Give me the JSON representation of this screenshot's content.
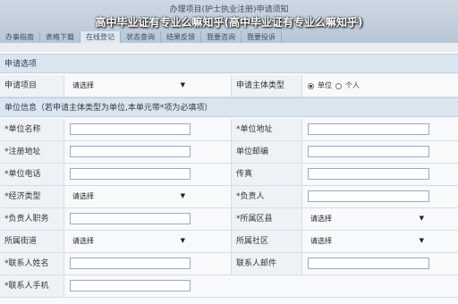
{
  "window_title": "办理项目(护士执业注册)申请须知",
  "overlay_title": "高中毕业证有专业么嘛知乎(高中毕业证有专业么嘛知乎)",
  "tabs": [
    "办事指南",
    "表格下载",
    "在线登记",
    "状态查询",
    "结果反馈",
    "我要咨询",
    "我要投诉"
  ],
  "section1": {
    "title": "申请选项"
  },
  "row_project": {
    "label": "申请项目",
    "select_value": "请选择",
    "right_label": "申请主体类型",
    "radio_unit": "单位",
    "radio_person": "个人"
  },
  "section2": {
    "title": "单位信息（若申请主体类型为单位,本单元带*项为必填项）"
  },
  "rows": {
    "unit_name": "*单位名称",
    "unit_addr": "*单位地址",
    "reg_addr": "*注册地址",
    "unit_email": "单位邮编",
    "unit_phone": "*单位电话",
    "fax": "传真",
    "econ_type": "*经济类型",
    "econ_value": "请选择",
    "leader": "*负责人",
    "leader_post": "*负责人职务",
    "area": "*所属区县",
    "area_value": "请选择",
    "street": "所属街道",
    "street_value": "请选择",
    "community": "所属社区",
    "community_value": "请选择",
    "contact_name": "*联系人姓名",
    "contact_email": "联系人邮件",
    "contact_phone": "*联系人手机"
  }
}
